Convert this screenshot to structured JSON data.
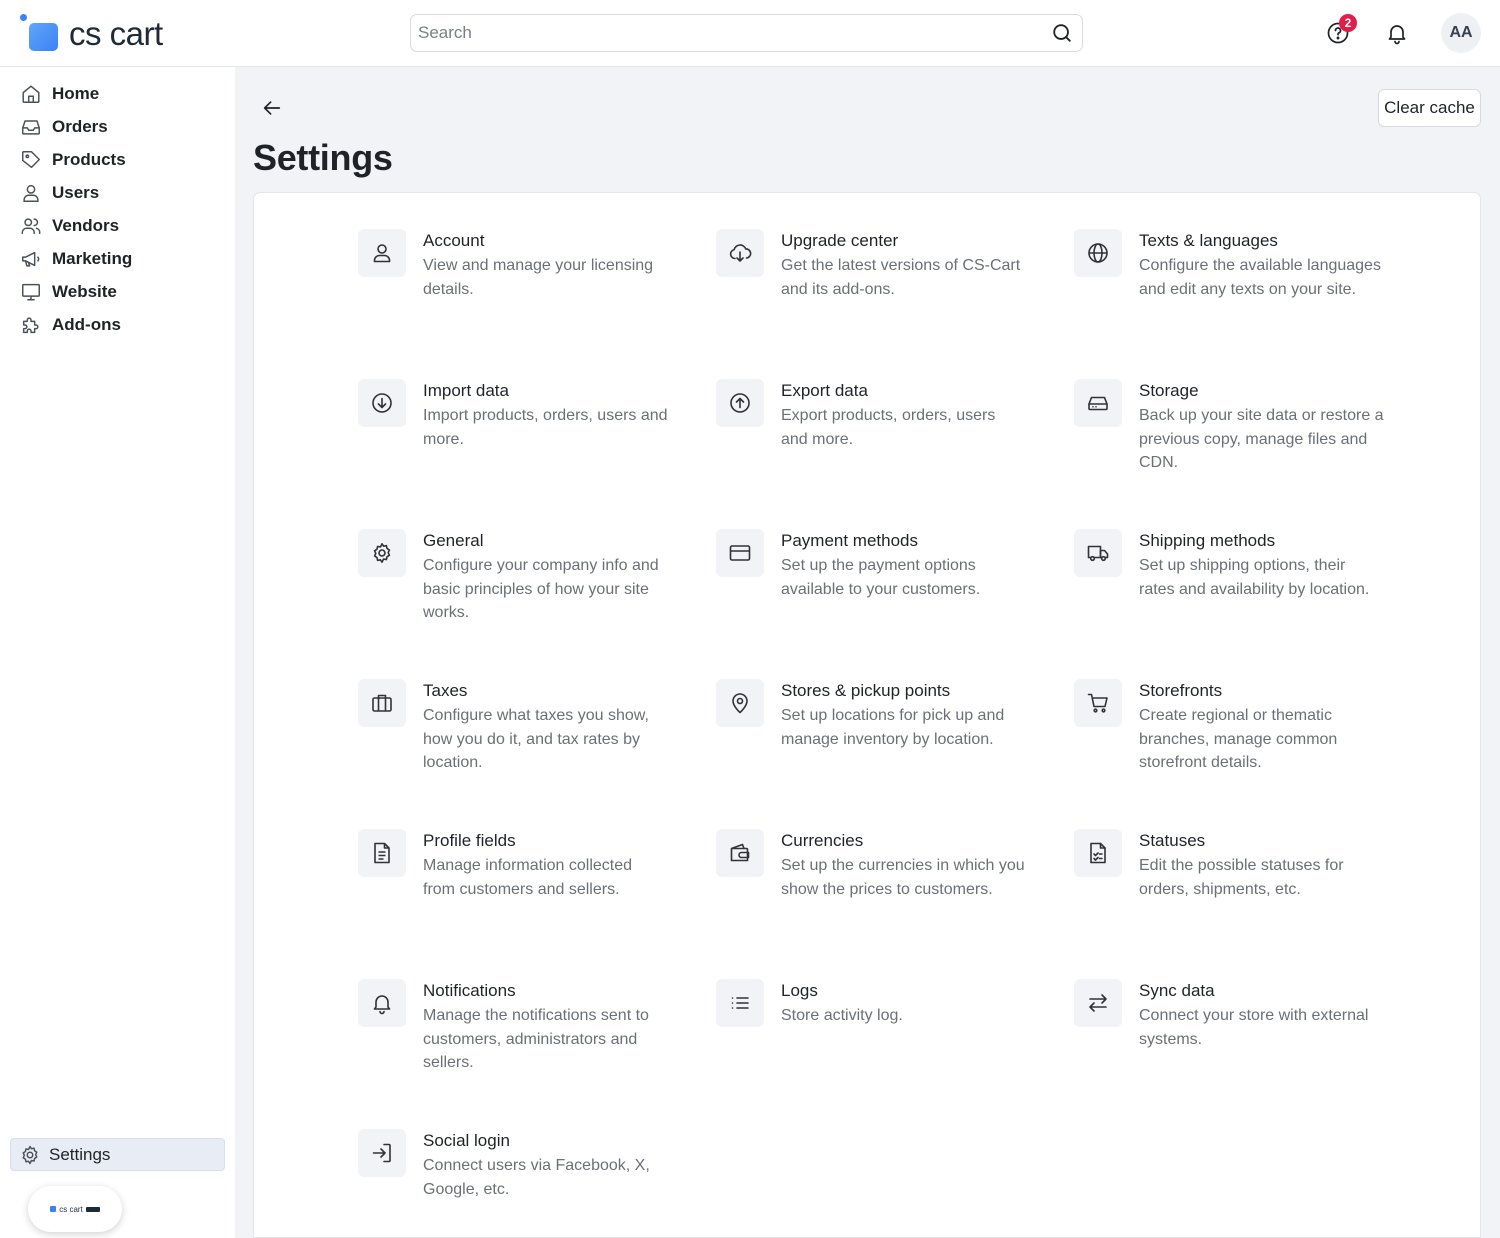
{
  "brand": {
    "name": "cs cart",
    "mini_label": "cs cart"
  },
  "search": {
    "placeholder": "Search"
  },
  "header": {
    "help_badge_count": "2",
    "avatar_initials": "AA"
  },
  "sidebar": {
    "items": [
      {
        "label": "Home",
        "icon": "home-icon"
      },
      {
        "label": "Orders",
        "icon": "inbox-icon"
      },
      {
        "label": "Products",
        "icon": "tag-icon"
      },
      {
        "label": "Users",
        "icon": "user-icon"
      },
      {
        "label": "Vendors",
        "icon": "users-icon"
      },
      {
        "label": "Marketing",
        "icon": "megaphone-icon"
      },
      {
        "label": "Website",
        "icon": "monitor-icon"
      },
      {
        "label": "Add-ons",
        "icon": "puzzle-icon"
      }
    ],
    "settings_label": "Settings"
  },
  "page": {
    "title": "Settings",
    "clear_cache_label": "Clear cache"
  },
  "settings_tiles": [
    {
      "title": "Account",
      "description": "View and manage your licensing details.",
      "icon": "user-icon"
    },
    {
      "title": "Upgrade center",
      "description": "Get the latest versions of CS-Cart and its add-ons.",
      "icon": "cloud-download-icon"
    },
    {
      "title": "Texts & languages",
      "description": "Configure the available languages and edit any texts on your site.",
      "icon": "globe-icon"
    },
    {
      "title": "Import data",
      "description": "Import products, orders, users and more.",
      "icon": "arrow-down-circle-icon"
    },
    {
      "title": "Export data",
      "description": "Export products, orders, users and more.",
      "icon": "arrow-up-circle-icon"
    },
    {
      "title": "Storage",
      "description": "Back up your site data or restore a previous copy, manage files and CDN.",
      "icon": "hard-drive-icon"
    },
    {
      "title": "General",
      "description": "Configure your company info and basic principles of how your site works.",
      "icon": "gear-icon"
    },
    {
      "title": "Payment methods",
      "description": "Set up the payment options available to your customers.",
      "icon": "credit-card-icon"
    },
    {
      "title": "Shipping methods",
      "description": "Set up shipping options, their rates and availability by location.",
      "icon": "truck-icon"
    },
    {
      "title": "Taxes",
      "description": "Configure what taxes you show, how you do it, and tax rates by location.",
      "icon": "briefcase-icon"
    },
    {
      "title": "Stores & pickup points",
      "description": "Set up locations for pick up and manage inventory by location.",
      "icon": "map-pin-icon"
    },
    {
      "title": "Storefronts",
      "description": "Create regional or thematic branches, manage common storefront details.",
      "icon": "cart-icon"
    },
    {
      "title": "Profile fields",
      "description": "Manage information collected from customers and sellers.",
      "icon": "document-icon"
    },
    {
      "title": "Currencies",
      "description": "Set up the currencies in which you show the prices to customers.",
      "icon": "wallet-icon"
    },
    {
      "title": "Statuses",
      "description": "Edit the possible statuses for orders, shipments, etc.",
      "icon": "file-check-icon"
    },
    {
      "title": "Notifications",
      "description": "Manage the notifications sent to customers, administrators and sellers.",
      "icon": "bell-icon"
    },
    {
      "title": "Logs",
      "description": "Store activity log.",
      "icon": "list-icon"
    },
    {
      "title": "Sync data",
      "description": "Connect your store with external systems.",
      "icon": "arrows-swap-icon"
    },
    {
      "title": "Social login",
      "description": "Connect users via Facebook, X, Google, etc.",
      "icon": "login-icon"
    }
  ]
}
